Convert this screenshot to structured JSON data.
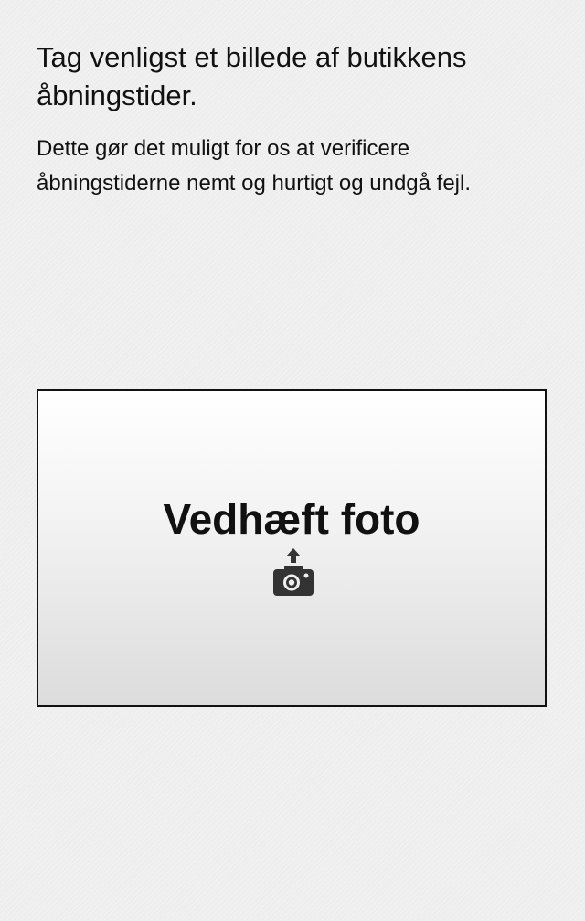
{
  "header": {
    "title": "Tag venligst et billede af butikkens åbningstider."
  },
  "body": {
    "description": "Dette gør det muligt for os at verificere åbningstiderne nemt og hurtigt og undgå fejl."
  },
  "attach": {
    "label": "Vedhæft foto",
    "icon": "camera-upload-icon"
  },
  "colors": {
    "background": "#efefef",
    "text": "#111111",
    "icon": "#333333"
  }
}
